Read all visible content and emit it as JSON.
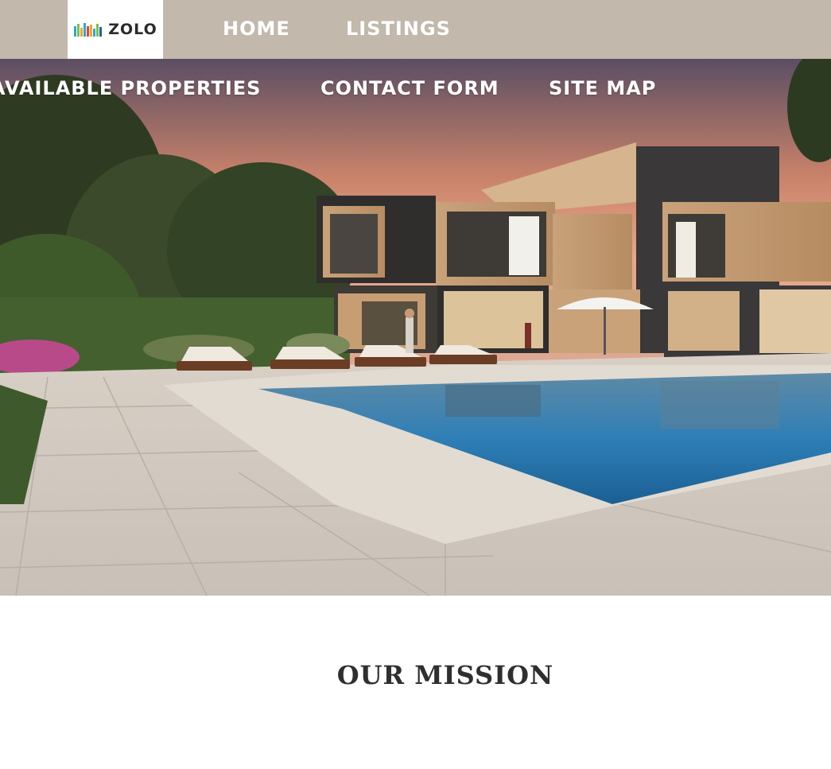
{
  "brand": {
    "name": "ZOLO"
  },
  "top_nav": {
    "items": [
      "HOME",
      "LISTINGS"
    ]
  },
  "sub_nav": {
    "items": [
      "AVAILABLE PROPERTIES",
      "CONTACT FORM",
      "SITE MAP"
    ]
  },
  "hero": {
    "image": "modern-house-with-pool-photo"
  },
  "mission": {
    "title": "OUR MISSION"
  },
  "colors": {
    "topbar": "#c2b8ab",
    "nav_text": "#ffffff",
    "heading": "#2f2f2f"
  }
}
